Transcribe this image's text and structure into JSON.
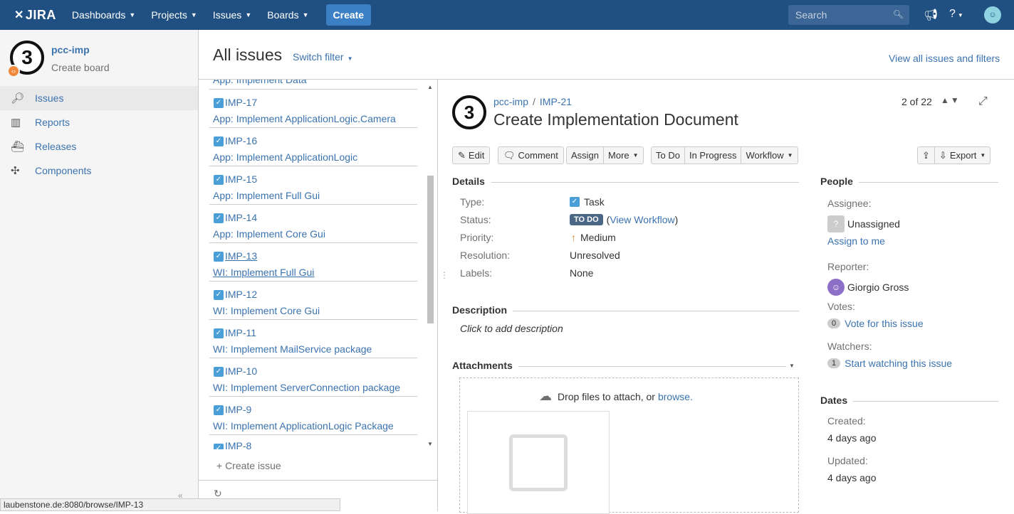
{
  "topnav": {
    "logo": "JIRA",
    "items": [
      "Dashboards",
      "Projects",
      "Issues",
      "Boards"
    ],
    "create": "Create",
    "search_placeholder": "Search"
  },
  "sidebar": {
    "project_name": "pcc-imp",
    "project_sub": "Create board",
    "project_avatar_digit": "3",
    "items": [
      {
        "label": "Issues",
        "icon": "issues-icon",
        "active": true
      },
      {
        "label": "Reports",
        "icon": "reports-icon",
        "active": false
      },
      {
        "label": "Releases",
        "icon": "releases-icon",
        "active": false
      },
      {
        "label": "Components",
        "icon": "components-icon",
        "active": false
      }
    ]
  },
  "header": {
    "title": "All issues",
    "switch_filter": "Switch filter",
    "view_all": "View all issues and filters"
  },
  "issue_list": {
    "top_cut_summary": "App: Implement Data",
    "items": [
      {
        "key": "IMP-17",
        "summary": "App: Implement ApplicationLogic.Camera"
      },
      {
        "key": "IMP-16",
        "summary": "App: Implement ApplicationLogic"
      },
      {
        "key": "IMP-15",
        "summary": "App: Implement Full Gui"
      },
      {
        "key": "IMP-14",
        "summary": "App: Implement Core Gui"
      },
      {
        "key": "IMP-13",
        "summary": "WI: Implement Full Gui"
      },
      {
        "key": "IMP-12",
        "summary": "WI: Implement Core Gui"
      },
      {
        "key": "IMP-11",
        "summary": "WI: Implement MailService package"
      },
      {
        "key": "IMP-10",
        "summary": "WI: Implement ServerConnection package"
      },
      {
        "key": "IMP-9",
        "summary": "WI: Implement ApplicationLogic Package"
      },
      {
        "key": "IMP-8",
        "summary": ""
      }
    ],
    "create_issue": "+ Create issue"
  },
  "issue": {
    "project": "pcc-imp",
    "key": "IMP-21",
    "title": "Create Implementation Document",
    "avatar_digit": "3",
    "pager": "2 of 22",
    "buttons": {
      "edit": "Edit",
      "comment": "Comment",
      "assign": "Assign",
      "more": "More",
      "todo": "To Do",
      "in_progress": "In Progress",
      "workflow": "Workflow",
      "export": "Export"
    },
    "details": {
      "heading": "Details",
      "type_label": "Type:",
      "type_value": "Task",
      "status_label": "Status:",
      "status_value": "TO DO",
      "status_link_open": "(",
      "status_link": "View Workflow",
      "status_link_close": ")",
      "priority_label": "Priority:",
      "priority_value": "Medium",
      "resolution_label": "Resolution:",
      "resolution_value": "Unresolved",
      "labels_label": "Labels:",
      "labels_value": "None"
    },
    "description": {
      "heading": "Description",
      "placeholder": "Click to add description"
    },
    "attachments": {
      "heading": "Attachments",
      "drop_text": "Drop files to attach, or ",
      "browse": "browse."
    },
    "people": {
      "heading": "People",
      "assignee_label": "Assignee:",
      "assignee": "Unassigned",
      "assign_to_me": "Assign to me",
      "reporter_label": "Reporter:",
      "reporter": "Giorgio Gross",
      "votes_label": "Votes:",
      "votes_count": "0",
      "vote_link": "Vote for this issue",
      "watchers_label": "Watchers:",
      "watchers_count": "1",
      "watch_link": "Start watching this issue"
    },
    "dates": {
      "heading": "Dates",
      "created_label": "Created:",
      "created": "4 days ago",
      "updated_label": "Updated:",
      "updated": "4 days ago"
    }
  },
  "statusbar": "laubenstone.de:8080/browse/IMP-13"
}
